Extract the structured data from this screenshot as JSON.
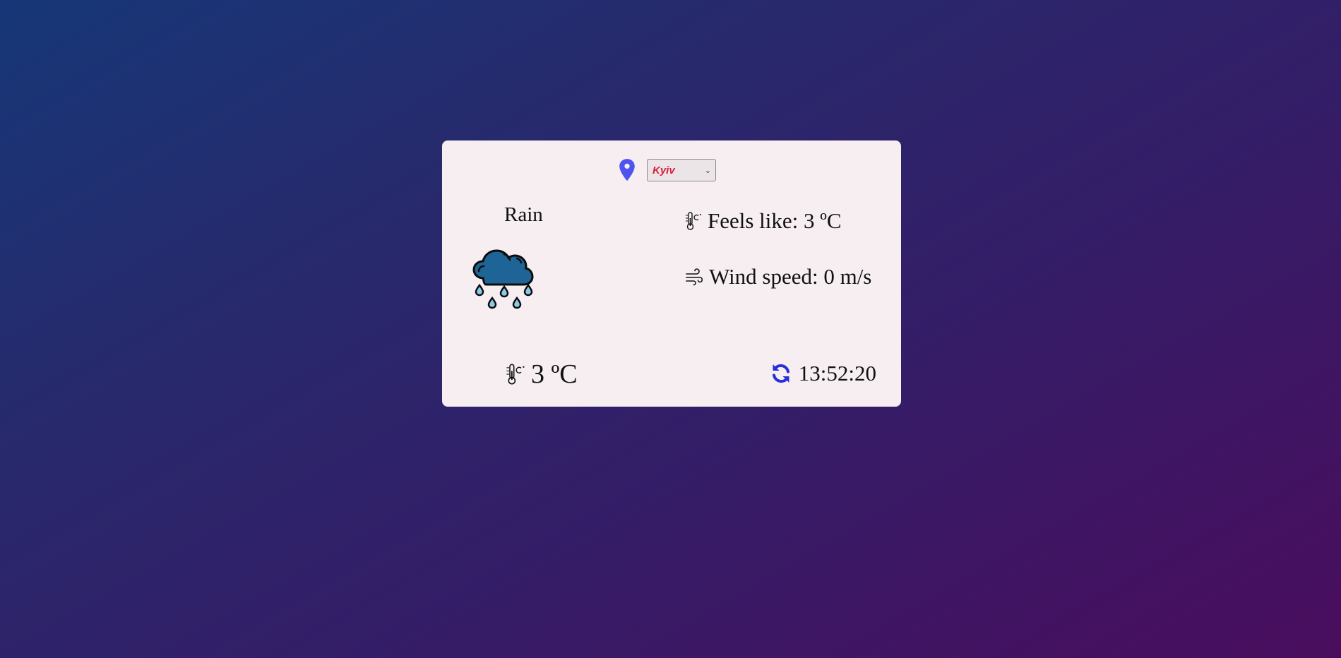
{
  "location": {
    "pin_icon": "map-marker-icon",
    "selected_city": "Kyiv",
    "select_color": "#d81f3a",
    "pin_color": "#4f53f0"
  },
  "weather": {
    "condition": "Rain",
    "condition_icon": "rain-cloud-icon",
    "feels_like_label": "Feels like: 3 ºC",
    "wind_speed_label": "Wind speed: 0 m/s",
    "temperature": "3 ºC",
    "updated_time": "13:52:20",
    "refresh_icon": "refresh-icon",
    "thermometer_icon": "thermometer-celsius-icon",
    "wind_icon": "wind-icon",
    "accent_color": "#2a2fdc"
  }
}
